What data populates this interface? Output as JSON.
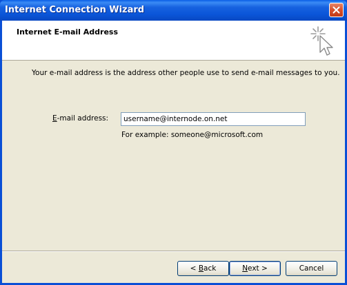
{
  "window": {
    "title": "Internet Connection Wizard",
    "close_icon": "close-icon"
  },
  "header": {
    "title": "Internet E-mail Address",
    "icon": "wizard-sparkle-cursor-icon"
  },
  "body": {
    "description": "Your e-mail address is the address other people use to send e-mail messages to you.",
    "email_label_accel": "E",
    "email_label_rest": "-mail address:",
    "email_value": "username@internode.on.net",
    "example": "For example: someone@microsoft.com"
  },
  "buttons": {
    "back_prefix": "< ",
    "back_accel": "B",
    "back_rest": "ack",
    "next_accel": "N",
    "next_rest": "ext >",
    "cancel": "Cancel"
  },
  "colors": {
    "titlebar": "#0a55d8",
    "client_bg": "#ece9d8",
    "close_button": "#d9502c",
    "input_border": "#7f9db9"
  }
}
